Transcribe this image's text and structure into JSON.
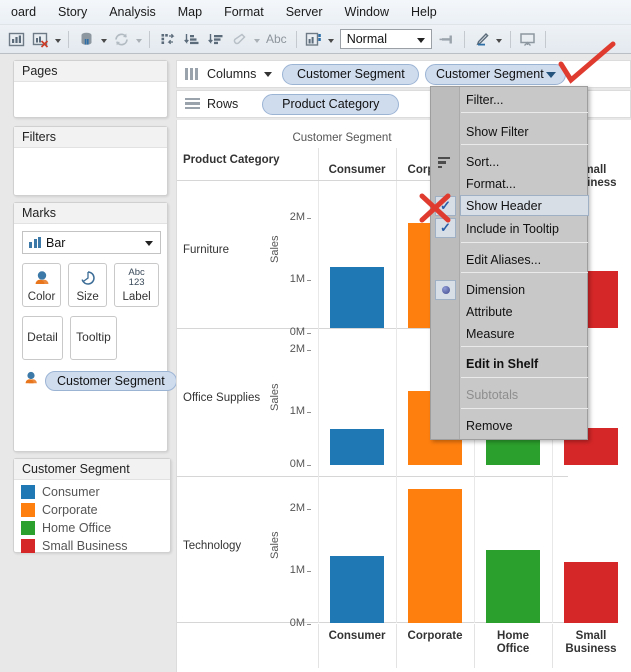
{
  "menubar": {
    "items": [
      {
        "label": "oard",
        "mnemonic": ""
      },
      {
        "label": "Story",
        "mnemonic": "t"
      },
      {
        "label": "Analysis",
        "mnemonic": "A"
      },
      {
        "label": "Map",
        "mnemonic": "M"
      },
      {
        "label": "Format",
        "mnemonic": "o"
      },
      {
        "label": "Server",
        "mnemonic": "S"
      },
      {
        "label": "Window",
        "mnemonic": "n"
      },
      {
        "label": "Help",
        "mnemonic": "H"
      }
    ]
  },
  "toolbar": {
    "icons": [
      "new-worksheet-icon",
      "duplicate-as-crosstab-icon",
      "clear-sheet-icon",
      "data-source-icon",
      "refresh-data-icon",
      "swap-rows-columns-icon",
      "sort-ascending-icon",
      "sort-descending-icon",
      "highlight-icon",
      "show-mark-labels-icon",
      "fit-selector-icon",
      "fix-axes-icon",
      "format-icon",
      "presentation-mode-icon"
    ],
    "abc_label": "Abc",
    "fit_value": "Normal"
  },
  "cards": {
    "pages": {
      "title": "Pages"
    },
    "filters": {
      "title": "Filters"
    },
    "marks": {
      "title": "Marks",
      "mark_type": "Bar",
      "buttons": [
        {
          "label": "Color",
          "icon": "color-icon"
        },
        {
          "label": "Size",
          "icon": "size-icon"
        },
        {
          "label": "Label",
          "icon": "abc123-icon"
        },
        {
          "label": "Detail",
          "icon": "detail-icon"
        },
        {
          "label": "Tooltip",
          "icon": "tooltip-icon"
        }
      ],
      "pill": "Customer Segment"
    },
    "legend": {
      "title": "Customer Segment",
      "items": [
        {
          "label": "Consumer",
          "color": "#1f77b4"
        },
        {
          "label": "Corporate",
          "color": "#ff7f0e"
        },
        {
          "label": "Home Office",
          "color": "#2ca02c"
        },
        {
          "label": "Small Business",
          "color": "#d62728"
        }
      ]
    }
  },
  "shelves": {
    "columns": {
      "label": "Columns",
      "icon": "columns-icon",
      "pills": [
        "Customer Segment",
        "Customer Segment"
      ]
    },
    "rows": {
      "label": "Rows",
      "icon": "rows-icon",
      "pills": [
        "Product Category"
      ]
    }
  },
  "context_menu": {
    "items": [
      {
        "label": "Filter...",
        "type": "normal"
      },
      {
        "label": "Show Filter",
        "type": "normal"
      },
      {
        "label": "Sort...",
        "type": "normal",
        "gutter": "sort-icon"
      },
      {
        "label": "Format...",
        "type": "normal"
      },
      {
        "label": "Show Header",
        "type": "checked",
        "selected": true
      },
      {
        "label": "Include in Tooltip",
        "type": "checked"
      },
      {
        "label": "Edit Aliases...",
        "type": "normal"
      },
      {
        "label": "Dimension",
        "type": "radio-selected"
      },
      {
        "label": "Attribute",
        "type": "normal"
      },
      {
        "label": "Measure",
        "type": "submenu"
      },
      {
        "label": "Edit in Shelf",
        "type": "bold"
      },
      {
        "label": "Subtotals",
        "type": "disabled"
      },
      {
        "label": "Remove",
        "type": "normal"
      }
    ],
    "check_glyph": "✓"
  },
  "annotations": {
    "color": "#e03b2f",
    "marks": [
      "checkmark-on-pill-dropdown",
      "x-over-show-header-checkbox"
    ]
  },
  "chart_data": {
    "type": "bar",
    "title": "Customer Segment",
    "xlabel": "Customer Segment",
    "ylabel": "Sales",
    "row_field": "Product Category",
    "categories": [
      "Consumer",
      "Corporate",
      "Home Office",
      "Small Business"
    ],
    "ytick_labels": [
      "0M",
      "1M",
      "2M"
    ],
    "ylim": [
      0,
      2.45
    ],
    "grid": true,
    "legend_position": "right-card",
    "panes": [
      {
        "row": "Furniture",
        "values": [
          1.06,
          1.83,
          1.0,
          1.0
        ],
        "colors": [
          "#1f77b4",
          "#ff7f0e",
          "#2ca02c",
          "#d62728"
        ]
      },
      {
        "row": "Office Supplies",
        "values": [
          0.66,
          1.38,
          0.66,
          0.68
        ],
        "colors": [
          "#1f77b4",
          "#ff7f0e",
          "#2ca02c",
          "#d62728"
        ]
      },
      {
        "row": "Technology",
        "values": [
          1.2,
          2.28,
          1.3,
          1.1
        ],
        "colors": [
          "#1f77b4",
          "#ff7f0e",
          "#2ca02c",
          "#d62728"
        ]
      }
    ]
  }
}
